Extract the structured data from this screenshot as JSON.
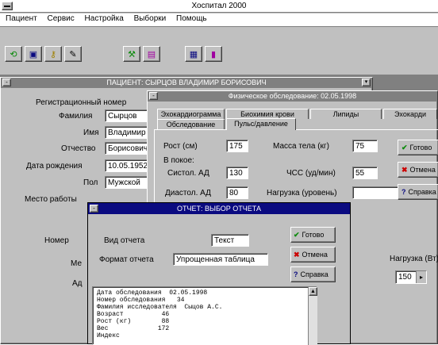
{
  "app": {
    "title": "Хоспитал 2000",
    "menu": [
      "Пациент",
      "Сервис",
      "Настройка",
      "Выборки",
      "Помощь"
    ],
    "toolbar_icons": [
      "refresh-icon",
      "card-icon",
      "key-icon",
      "edit-icon",
      "tools-icon",
      "books-icon",
      "calculator-icon",
      "book-icon"
    ]
  },
  "patient_window": {
    "caption": "ПАЦИЕНТ: СЫРЦОВ ВЛАДИМИР БОРИСОВИЧ",
    "fields": [
      {
        "label": "Регистрационный номер",
        "value": ""
      },
      {
        "label": "Фамилия",
        "value": "Сырцов"
      },
      {
        "label": "Имя",
        "value": "Владимир"
      },
      {
        "label": "Отчество",
        "value": "Борисович"
      },
      {
        "label": "Дата рождения",
        "value": "10.05.1952"
      },
      {
        "label": "Пол",
        "value": "Мужской"
      },
      {
        "label": "Место работы",
        "value": ""
      },
      {
        "label": "Номер",
        "value": ""
      },
      {
        "label": "Ме",
        "value": ""
      },
      {
        "label": "Ад",
        "value": ""
      }
    ]
  },
  "exam_window": {
    "caption": "Физическое обследование: 02.05.1998",
    "tabs_top": [
      "Эхокардиограмма",
      "Биохимия крови",
      "Липиды",
      "Эхокарди"
    ],
    "tabs_bottom": [
      "Обследование",
      "Пульс/давление"
    ],
    "fields": {
      "height_label": "Рост (см)",
      "height_value": "175",
      "weight_label": "Масса тела (кг)",
      "weight_value": "75",
      "rest_label": "В покое:",
      "systolic_label": "Систол. АД",
      "systolic_value": "130",
      "diastolic_label": "Диастол. АД",
      "diastolic_value": "80",
      "hr_label": "ЧСС (уд/мин)",
      "hr_value": "55",
      "hypertrophy_label": "Нагрузка (уровень)",
      "hypertrophy_value": ""
    },
    "buttons": {
      "ok": "Готово",
      "cancel": "Отмена",
      "help": "Справка"
    },
    "load_label": "Нагрузка (Вт)",
    "load_value": "150"
  },
  "report_window": {
    "caption": "ОТЧЕТ: ВЫБОР ОТЧЕТА",
    "type_label": "Вид отчета",
    "type_value": "Текст",
    "form_label": "Формат отчета",
    "form_value": "Упрощенная таблица",
    "buttons": {
      "ok": "Готово",
      "cancel": "Отмена",
      "help": "Справка"
    },
    "preview_lines": [
      "Дата обследования  02.05.1998",
      "Номер обследования   34",
      "Фамилия исследователя  Сыцов А.С.",
      "Возраст          46",
      "Рост (кг)        88",
      "Вес             172",
      "Индекс"
    ]
  },
  "colors": {
    "active_title": "#0a0a80",
    "inactive_title": "#808080",
    "dialog_face": "#c0c0c0",
    "green_check": "#0a8a0a",
    "red_x": "#cc0000",
    "desktop": "#808080"
  }
}
